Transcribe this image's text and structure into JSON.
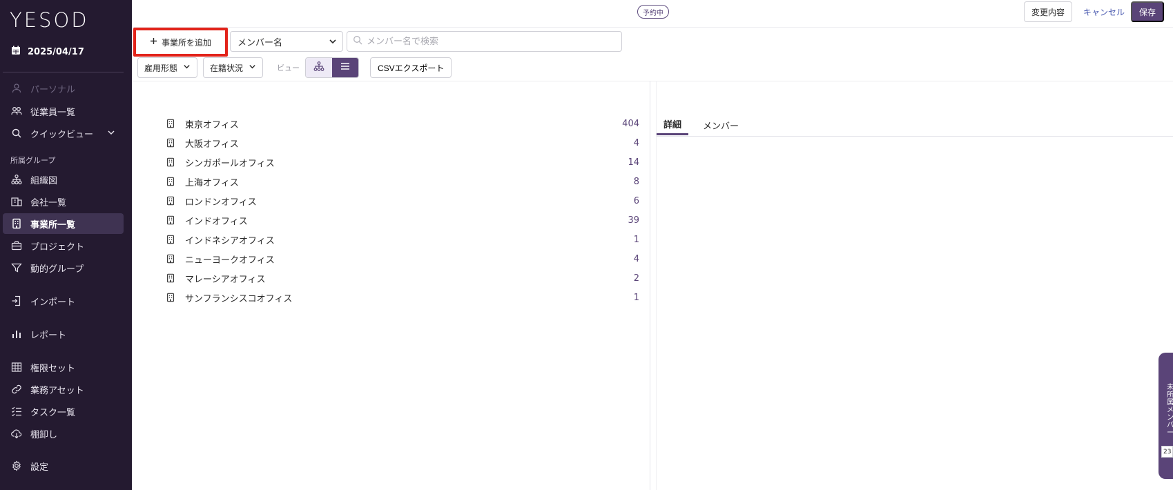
{
  "sidebar": {
    "logo": "YESOD",
    "date": "2025/04/17",
    "personal": "パーソナル",
    "employees": "従業員一覧",
    "quickview": "クイックビュー",
    "section_label": "所属グループ",
    "org_chart": "組織図",
    "companies": "会社一覧",
    "offices": "事業所一覧",
    "projects": "プロジェクト",
    "dynamic_groups": "動的グループ",
    "import": "インポート",
    "reports": "レポート",
    "permission_sets": "権限セット",
    "business_assets": "業務アセット",
    "tasks": "タスク一覧",
    "inventory": "棚卸し",
    "settings": "設定"
  },
  "topbar": {
    "status_badge": "予約中",
    "changes": "変更内容",
    "cancel": "キャンセル",
    "save": "保存"
  },
  "toolbar": {
    "add_office": "事業所を追加",
    "select_value": "メンバー名",
    "search_placeholder": "メンバー名で検索",
    "employment_type": "雇用形態",
    "enrollment_status": "在籍状況",
    "view_label": "ビュー",
    "csv_export": "CSVエクスポート"
  },
  "offices": [
    {
      "name": "東京オフィス",
      "count": "404"
    },
    {
      "name": "大阪オフィス",
      "count": "4"
    },
    {
      "name": "シンガポールオフィス",
      "count": "14"
    },
    {
      "name": "上海オフィス",
      "count": "8"
    },
    {
      "name": "ロンドンオフィス",
      "count": "6"
    },
    {
      "name": "インドオフィス",
      "count": "39"
    },
    {
      "name": "インドネシアオフィス",
      "count": "1"
    },
    {
      "name": "ニューヨークオフィス",
      "count": "4"
    },
    {
      "name": "マレーシアオフィス",
      "count": "2"
    },
    {
      "name": "サンフランシスコオフィス",
      "count": "1"
    }
  ],
  "detail_tabs": {
    "details": "詳細",
    "members": "メンバー"
  },
  "unassigned": {
    "label": "未所属メンバー",
    "count": "23"
  },
  "colors": {
    "sidebar_bg": "#241a30",
    "accent": "#5a4478",
    "highlight_box": "#e2231a",
    "link": "#4a5ab0"
  },
  "icons": {
    "date": "calendar-icon",
    "personal": "person-icon",
    "employees": "people-icon",
    "quickview": "search-icon",
    "org_chart": "org-chart-icon",
    "companies": "company-icon",
    "offices": "building-icon",
    "projects": "briefcase-icon",
    "dynamic_groups": "filter-icon",
    "import": "import-icon",
    "reports": "bar-chart-icon",
    "permission_sets": "grid-icon",
    "business_assets": "link-icon",
    "tasks": "checklist-icon",
    "inventory": "download-cloud-icon",
    "settings": "gear-icon"
  }
}
